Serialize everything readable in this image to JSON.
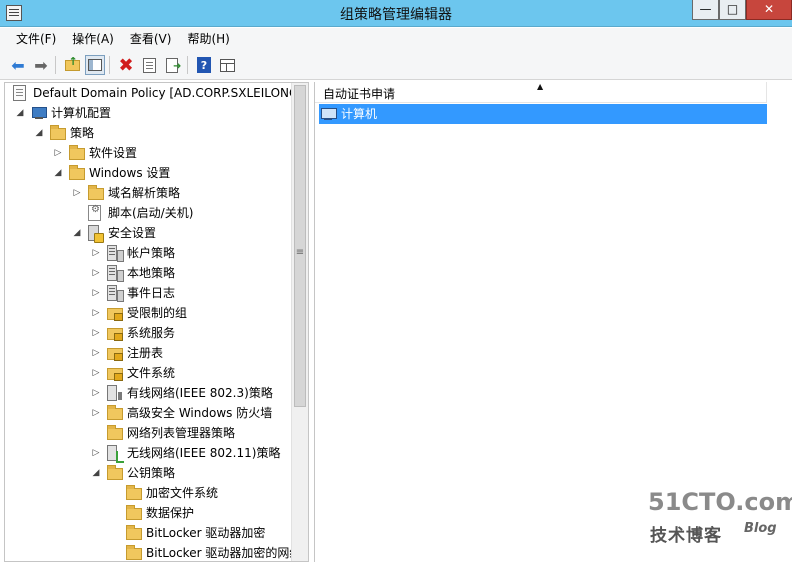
{
  "window": {
    "title": "组策略管理编辑器",
    "min_glyph": "—",
    "max_glyph": "□",
    "close_glyph": "✕"
  },
  "menu": {
    "file": "文件(F)",
    "action": "操作(A)",
    "view": "查看(V)",
    "help": "帮助(H)"
  },
  "toolbar": {
    "back_glyph": "⬅",
    "forward_glyph": "➡",
    "delete_glyph": "✖",
    "help_glyph": "?"
  },
  "tree": {
    "items": [
      {
        "label": "Default Domain Policy [AD.CORP.SXLEILONG.",
        "toggle": "",
        "icon": "document-icon"
      },
      {
        "label": "计算机配置",
        "toggle": "◢",
        "icon": "computer-icon"
      },
      {
        "label": "策略",
        "toggle": "◢",
        "icon": "folder-icon"
      },
      {
        "label": "软件设置",
        "toggle": "▷",
        "icon": "folder-icon"
      },
      {
        "label": "Windows 设置",
        "toggle": "◢",
        "icon": "folder-icon"
      },
      {
        "label": "域名解析策略",
        "toggle": "▷",
        "icon": "folder-icon"
      },
      {
        "label": "脚本(启动/关机)",
        "toggle": "",
        "icon": "script-icon"
      },
      {
        "label": "安全设置",
        "toggle": "◢",
        "icon": "security-settings-icon"
      },
      {
        "label": "帐户策略",
        "toggle": "▷",
        "icon": "server-icon"
      },
      {
        "label": "本地策略",
        "toggle": "▷",
        "icon": "server-icon"
      },
      {
        "label": "事件日志",
        "toggle": "▷",
        "icon": "server-icon"
      },
      {
        "label": "受限制的组",
        "toggle": "▷",
        "icon": "locked-folder-icon"
      },
      {
        "label": "系统服务",
        "toggle": "▷",
        "icon": "locked-folder-icon"
      },
      {
        "label": "注册表",
        "toggle": "▷",
        "icon": "locked-folder-icon"
      },
      {
        "label": "文件系统",
        "toggle": "▷",
        "icon": "locked-folder-icon"
      },
      {
        "label": "有线网络(IEEE 802.3)策略",
        "toggle": "▷",
        "icon": "wired-network-icon"
      },
      {
        "label": "高级安全 Windows 防火墙",
        "toggle": "▷",
        "icon": "folder-icon"
      },
      {
        "label": "网络列表管理器策略",
        "toggle": "",
        "icon": "folder-icon"
      },
      {
        "label": "无线网络(IEEE 802.11)策略",
        "toggle": "▷",
        "icon": "wireless-network-icon"
      },
      {
        "label": "公钥策略",
        "toggle": "◢",
        "icon": "folder-icon"
      },
      {
        "label": "加密文件系统",
        "toggle": "",
        "icon": "folder-icon"
      },
      {
        "label": "数据保护",
        "toggle": "",
        "icon": "folder-icon"
      },
      {
        "label": "BitLocker 驱动器加密",
        "toggle": "",
        "icon": "folder-icon"
      },
      {
        "label": "BitLocker 驱动器加密的网络",
        "toggle": "",
        "icon": "folder-icon"
      }
    ],
    "scroll_grip": "≡"
  },
  "list": {
    "column_header": "自动证书申请",
    "sort_glyph": "▲",
    "rows": [
      {
        "label": "计算机",
        "icon": "computer-icon",
        "selected": true
      }
    ]
  },
  "watermark": {
    "site": "51CTO.com",
    "tagline": "技术博客",
    "blog": "Blog"
  },
  "colors": {
    "titlebar": "#6cc6ee",
    "selection": "#3399ff",
    "close_button": "#c7463d"
  }
}
